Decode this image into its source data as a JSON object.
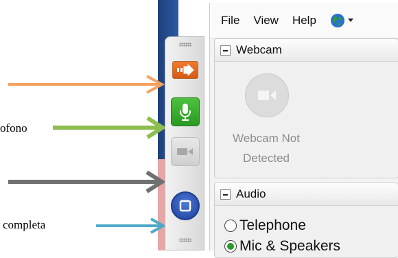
{
  "annotations": {
    "mic_label": "ofono",
    "full_label": "completa"
  },
  "menu": {
    "file": "File",
    "view": "View",
    "help": "Help"
  },
  "webcam_panel": {
    "title": "Webcam",
    "status_line1": "Webcam Not",
    "status_line2": "Detected"
  },
  "audio_panel": {
    "title": "Audio",
    "options": [
      {
        "label": "Telephone",
        "selected": false
      },
      {
        "label": "Mic & Speakers",
        "selected": true
      }
    ]
  },
  "colors": {
    "arrow_orange": "#f4a261",
    "arrow_green": "#8cbd4e",
    "arrow_gray": "#707070",
    "arrow_teal": "#4fa9c6"
  },
  "icons": {
    "toolbar": [
      "grip-icon",
      "arrow-right-icon",
      "microphone-icon",
      "video-camera-icon",
      "fullscreen-icon",
      "grip-icon"
    ],
    "menu": "globe-icon"
  }
}
